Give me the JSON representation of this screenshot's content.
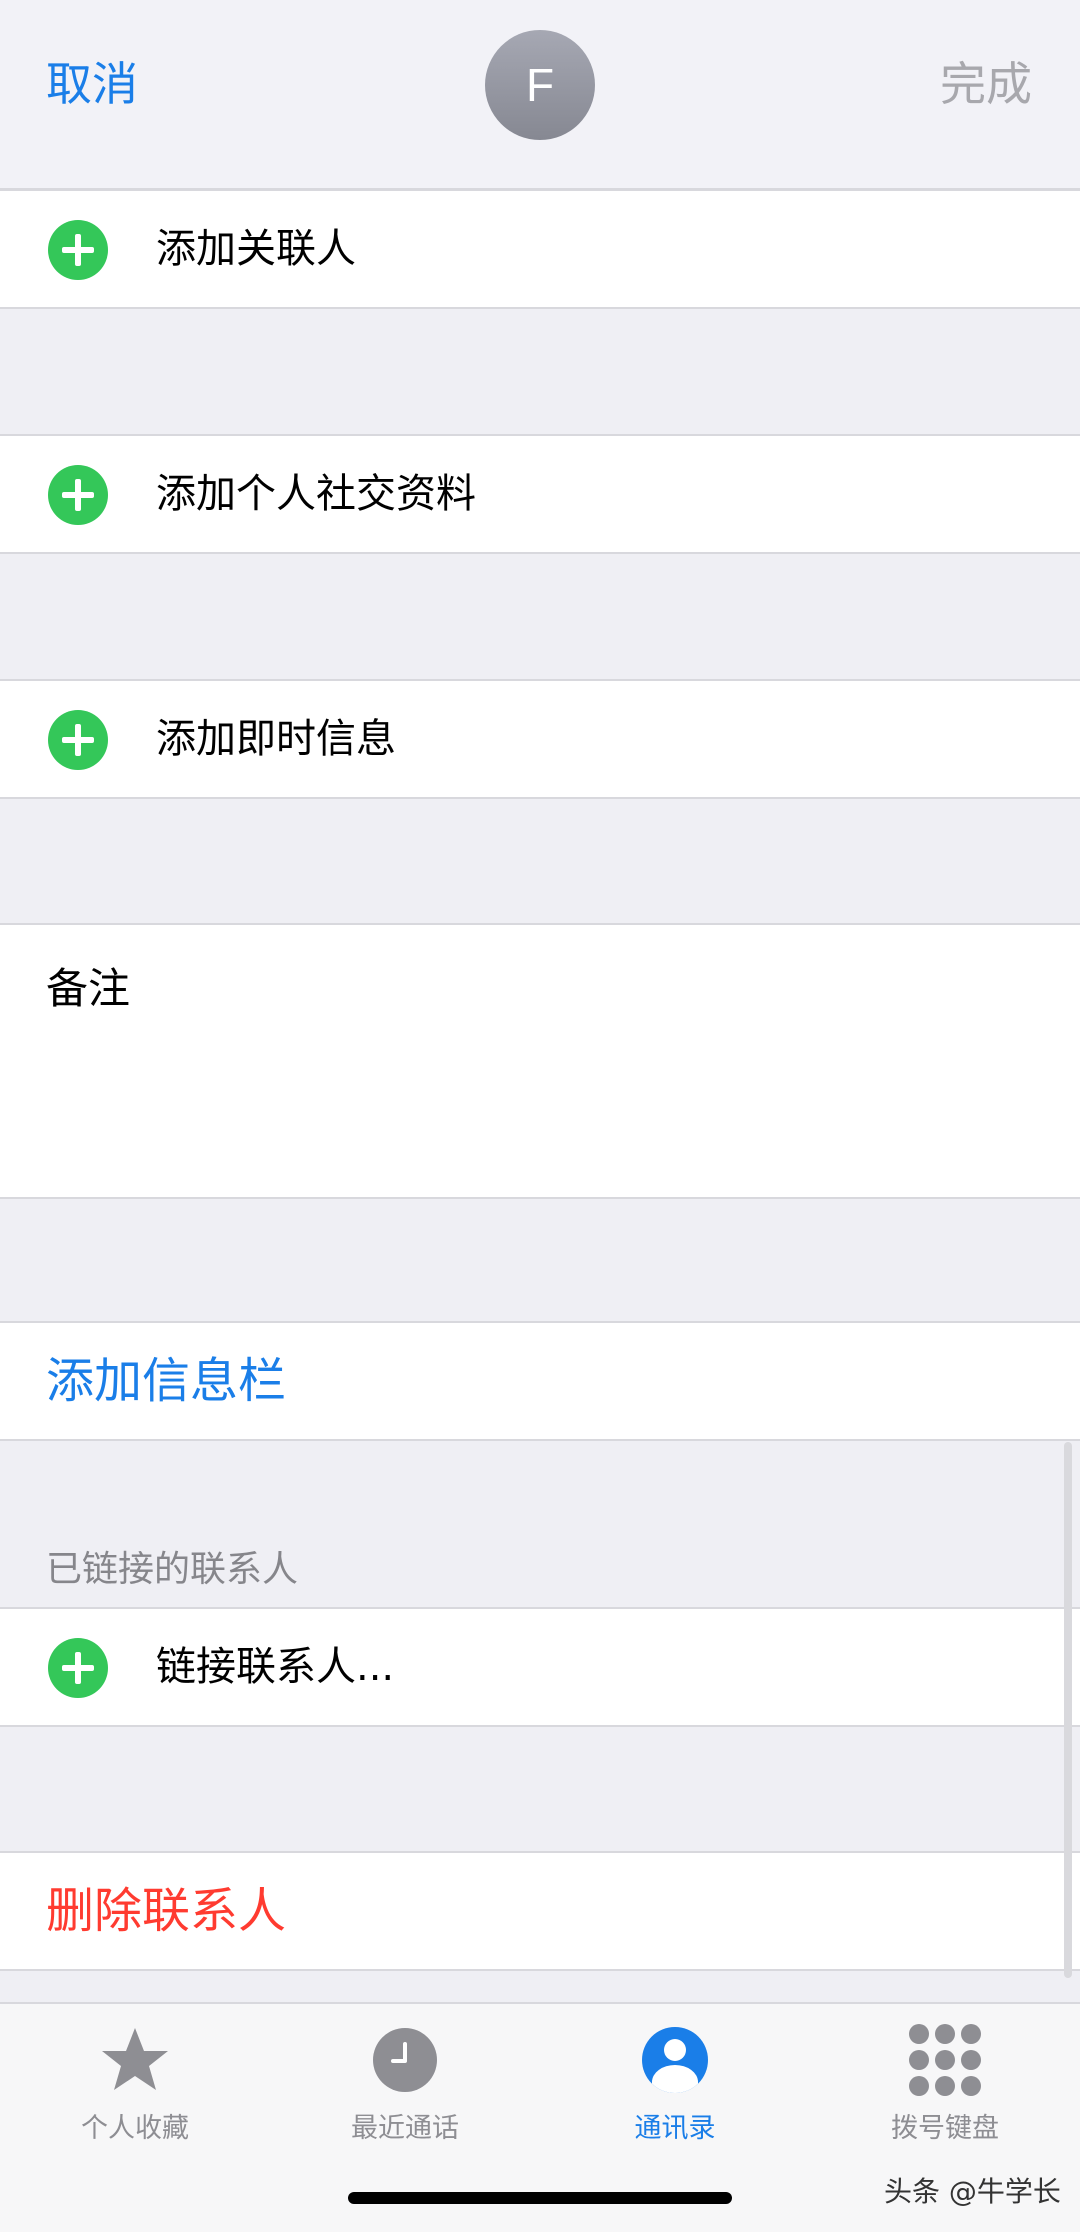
{
  "header": {
    "cancel_label": "取消",
    "done_label": "完成",
    "avatar_initial": "F"
  },
  "rows": {
    "add_related": "添加关联人",
    "add_social": "添加个人社交资料",
    "add_im": "添加即时信息",
    "notes_label": "备注",
    "add_field": "添加信息栏",
    "linked_header": "已链接的联系人",
    "link_contacts": "链接联系人...",
    "delete_contact": "删除联系人"
  },
  "tabbar": {
    "items": [
      {
        "label": "个人收藏",
        "icon": "star-icon"
      },
      {
        "label": "最近通话",
        "icon": "clock-icon"
      },
      {
        "label": "通讯录",
        "icon": "contacts-icon"
      },
      {
        "label": "拨号键盘",
        "icon": "keypad-icon"
      }
    ]
  },
  "watermark": "头条 @牛学长",
  "colors": {
    "accent": "#1a7ee8",
    "green": "#34c759",
    "destructive": "#ff3b30"
  }
}
